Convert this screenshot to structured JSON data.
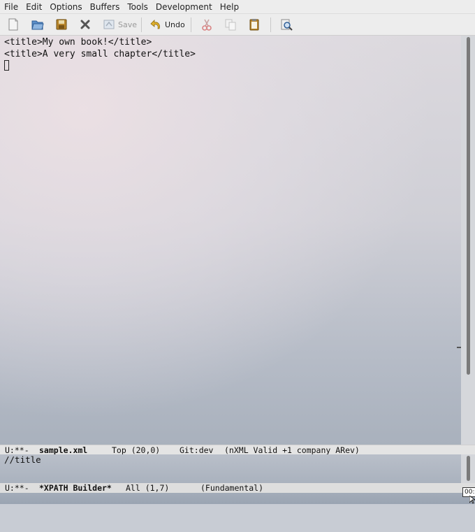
{
  "menu": [
    "File",
    "Edit",
    "Options",
    "Buffers",
    "Tools",
    "Development",
    "Help"
  ],
  "toolbar": {
    "save_label": "Save",
    "undo_label": "Undo"
  },
  "editor": {
    "lines": [
      "<title>My own book!</title>",
      "<title>A very small chapter</title>"
    ]
  },
  "modeline_top": {
    "status": "U:**-",
    "buffer": "sample.xml",
    "position": "Top (20,0)",
    "vc": "Git:dev",
    "modes": "(nXML Valid +1 company ARev)"
  },
  "minibuffer": {
    "text": "//title"
  },
  "modeline_bottom": {
    "status": "U:**-",
    "buffer": "*XPATH Builder*",
    "position": "All (1,7)",
    "modes": "(Fundamental)"
  },
  "tooltip": {
    "text": "00:"
  }
}
